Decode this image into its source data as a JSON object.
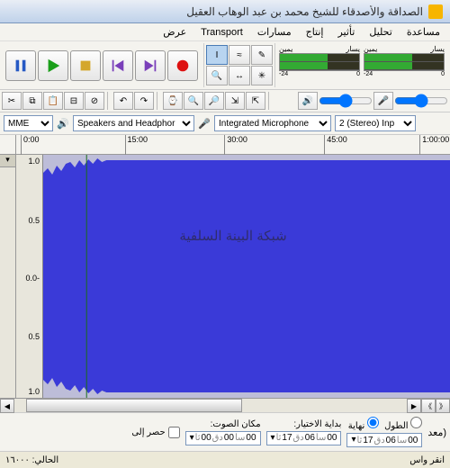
{
  "title": "الصداقة والأصدقاء للشيخ محمد بن عبد الوهاب العقيل",
  "menu": {
    "file": "عرض",
    "transport": "Transport",
    "tracks": "مسارات",
    "generate": "إنتاج",
    "effect": "تأثير",
    "analyze": "تحليل",
    "help": "مساعدة"
  },
  "meter": {
    "L": "يسار",
    "R": "يمين",
    "ticks": [
      "-24",
      "",
      "0"
    ]
  },
  "devices": {
    "host": "MME",
    "output": "Speakers and Headphor",
    "input": "Integrated Microphone",
    "channels": "2 (Stereo) Inp"
  },
  "timeline": {
    "ticks": [
      "0:00",
      "15:00",
      "30:00",
      "45:00",
      "1:00:00"
    ]
  },
  "vscale": {
    "top": "1.0",
    "up": "0.5",
    "mid": "0.0-"
  },
  "watermark": "شبكة البينة السلفية",
  "selection": {
    "pos_label": "مكان الصوت:",
    "start_label": "بداية الاختيار:",
    "end_radio": "نهاية",
    "len_radio": "الطول",
    "snap": "حصر إلى",
    "proj": "(معد",
    "pos": {
      "h": "00",
      "m": "00",
      "s": "00",
      "f": "000"
    },
    "start": {
      "h": "00",
      "m": "06",
      "s": "17",
      "f": "ثا"
    },
    "end": {
      "h": "00",
      "m": "06",
      "s": "17",
      "f": "ثا"
    },
    "unit_h": "سا",
    "unit_m": "دق",
    "unit_f": "ثا"
  },
  "status": {
    "hint": "انقر واس",
    "rate_lbl": "الحالي:",
    "rate": "١٦٠٠٠"
  }
}
